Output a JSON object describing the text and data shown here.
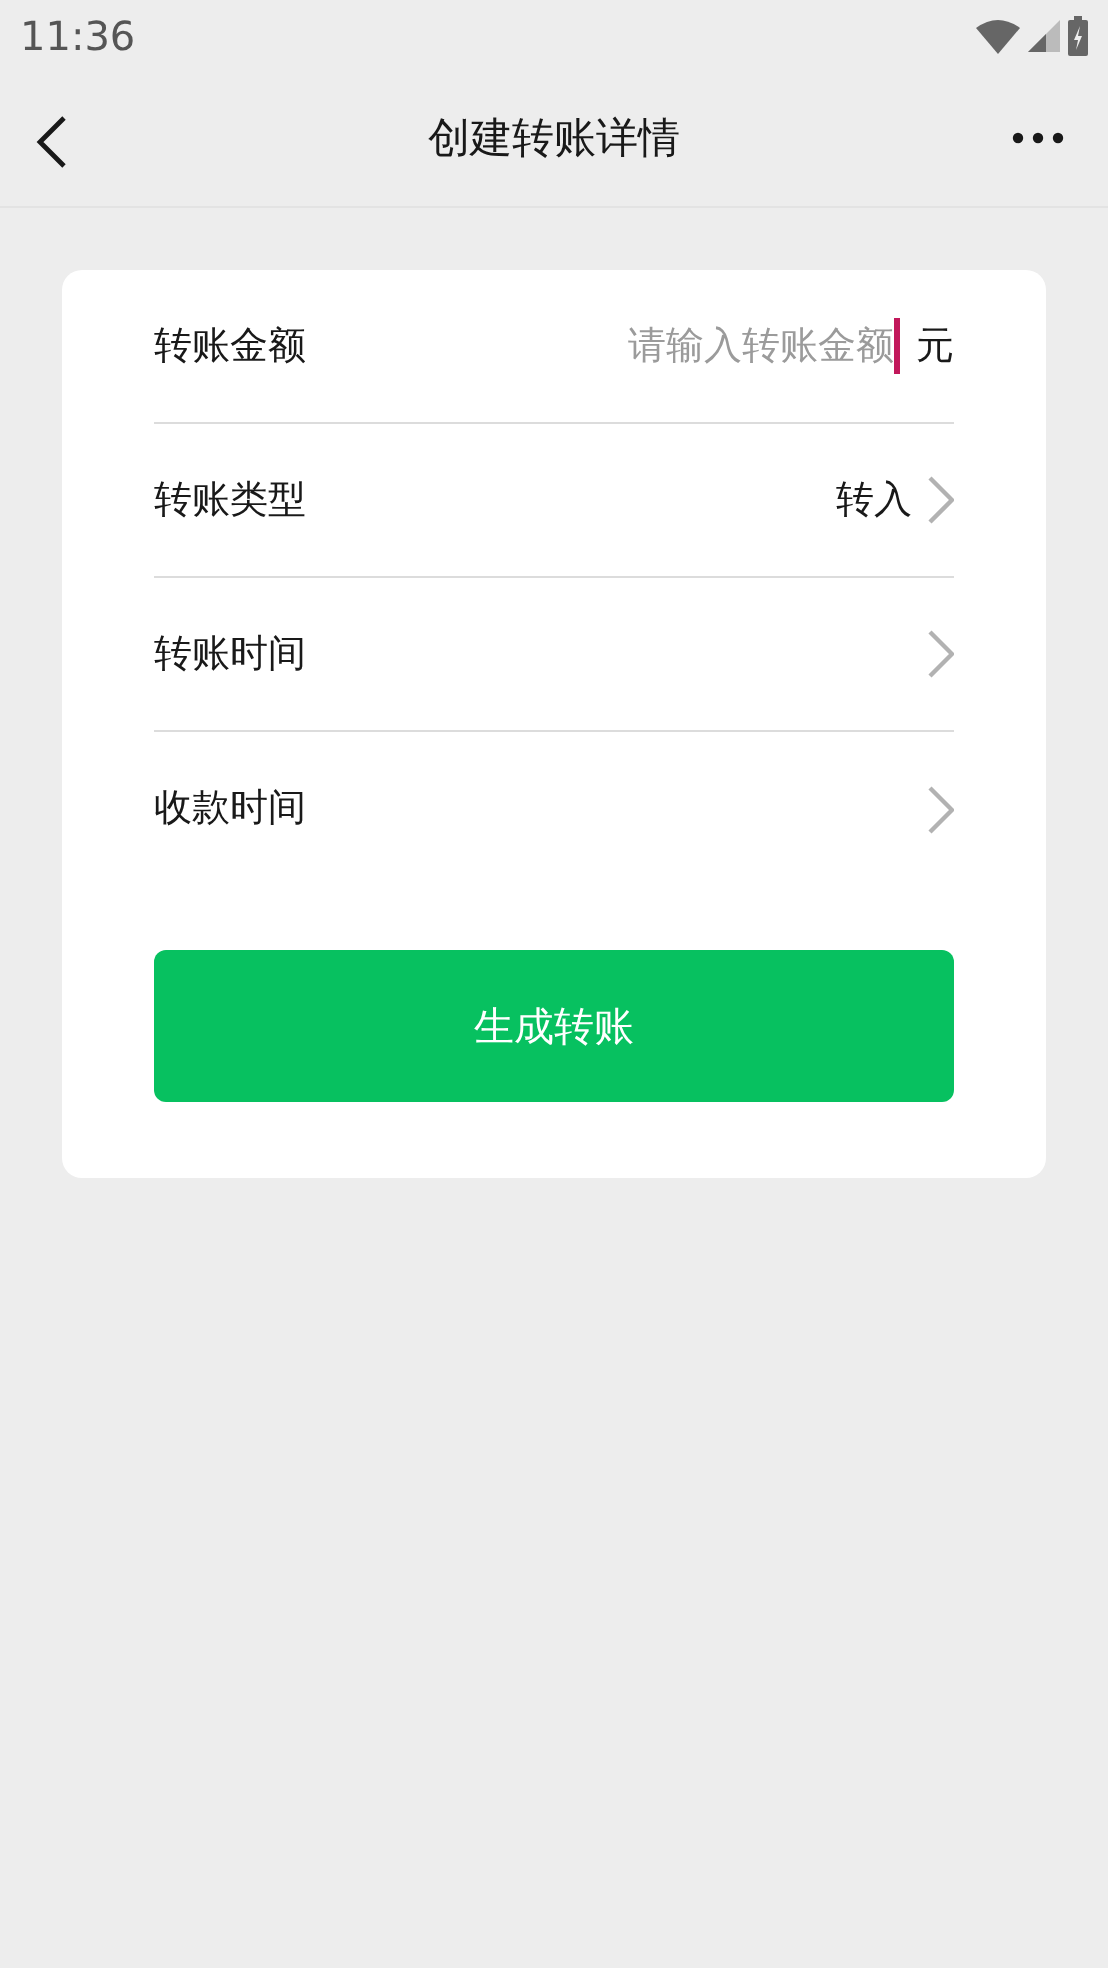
{
  "status_bar": {
    "time": "11:36"
  },
  "header": {
    "title": "创建转账详情"
  },
  "form": {
    "rows": [
      {
        "kind": "input",
        "label": "转账金额",
        "placeholder": "请输入转账金额",
        "unit": "元"
      },
      {
        "kind": "select",
        "label": "转账类型",
        "value": "转入"
      },
      {
        "kind": "select",
        "label": "转账时间"
      },
      {
        "kind": "select",
        "label": "收款时间"
      }
    ],
    "submit": "生成转账"
  }
}
